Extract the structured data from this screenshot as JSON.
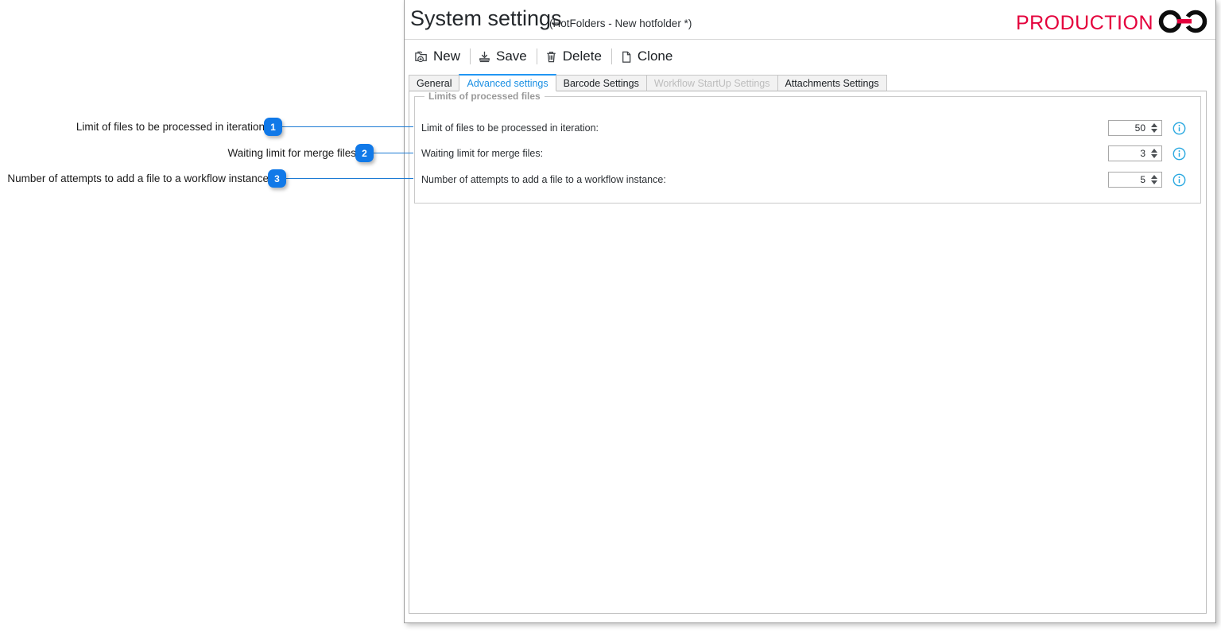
{
  "window": {
    "title": "System settings",
    "subtitle": "(HotFolders - New hotfolder *)",
    "brand": "PRODUCTION",
    "brand_color": "#e4003c",
    "logo_icon": "chain-link-logo"
  },
  "toolbar": {
    "items": [
      {
        "label": "New",
        "icon": "new-folder-icon"
      },
      {
        "label": "Save",
        "icon": "save-disk-icon"
      },
      {
        "label": "Delete",
        "icon": "trash-icon"
      },
      {
        "label": "Clone",
        "icon": "document-copy-icon"
      }
    ]
  },
  "tabs": [
    {
      "label": "General",
      "state": "normal"
    },
    {
      "label": "Advanced settings",
      "state": "active"
    },
    {
      "label": "Barcode Settings",
      "state": "normal"
    },
    {
      "label": "Workflow StartUp Settings",
      "state": "disabled"
    },
    {
      "label": "Attachments Settings",
      "state": "normal"
    }
  ],
  "group": {
    "legend": "Limits of processed files",
    "rows": [
      {
        "label": "Limit of files to be processed in iteration:",
        "value": "50",
        "info": "info-icon"
      },
      {
        "label": "Waiting limit for merge files:",
        "value": "3",
        "info": "info-icon"
      },
      {
        "label": "Number of attempts to add a file to a workflow instance:",
        "value": "5",
        "info": "info-icon"
      }
    ]
  },
  "callouts": [
    {
      "number": "1",
      "label": "Limit of files to be processed in iteration"
    },
    {
      "number": "2",
      "label": "Waiting limit for merge files"
    },
    {
      "number": "3",
      "label": "Number of attempts to add a file to a workflow instance"
    }
  ],
  "colors": {
    "accent_blue": "#1179e8",
    "tab_active": "#1a8fe3",
    "brand_red": "#e4003c"
  }
}
